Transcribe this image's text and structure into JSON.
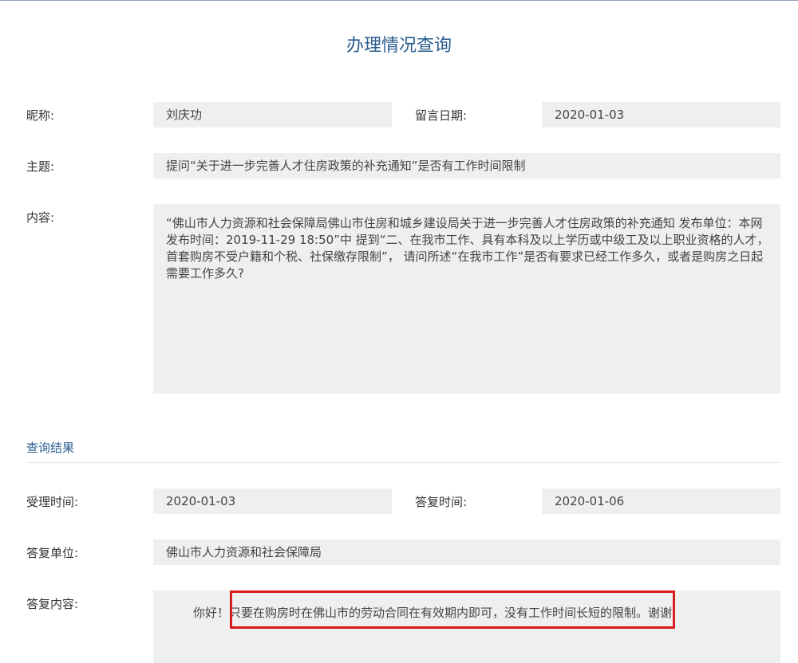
{
  "page": {
    "title": "办理情况查询"
  },
  "message": {
    "nickname_label": "昵称:",
    "nickname": "刘庆功",
    "date_label": "留言日期:",
    "date": "2020-01-03",
    "subject_label": "主题:",
    "subject": "提问“关于进一步完善人才住房政策的补充通知”是否有工作时间限制",
    "content_label": "内容:",
    "content": "“佛山市人力资源和社会保障局佛山市住房和城乡建设局关于进一步完善人才住房政策的补充通知 发布单位：本网 发布时间：2019-11-29 18:50”中 提到“二、在我市工作、具有本科及以上学历或中级工及以上职业资格的人才，首套购房不受户籍和个税、社保缴存限制”， 请问所述“在我市工作”是否有要求已经工作多久，或者是购房之日起需要工作多久?"
  },
  "result": {
    "section_title": "查询结果",
    "accept_time_label": "受理时间:",
    "accept_time": "2020-01-03",
    "reply_time_label": "答复时间:",
    "reply_time": "2020-01-06",
    "reply_unit_label": "答复单位:",
    "reply_unit": "佛山市人力资源和社会保障局",
    "reply_content_label": "答复内容:",
    "reply_content": "你好！只要在购房时在佛山市的劳动合同在有效期内即可，没有工作时间长短的限制。谢谢"
  },
  "colors": {
    "accent": "#2a5d8f",
    "field_bg": "#efefef",
    "highlight": "#d81c1c"
  }
}
